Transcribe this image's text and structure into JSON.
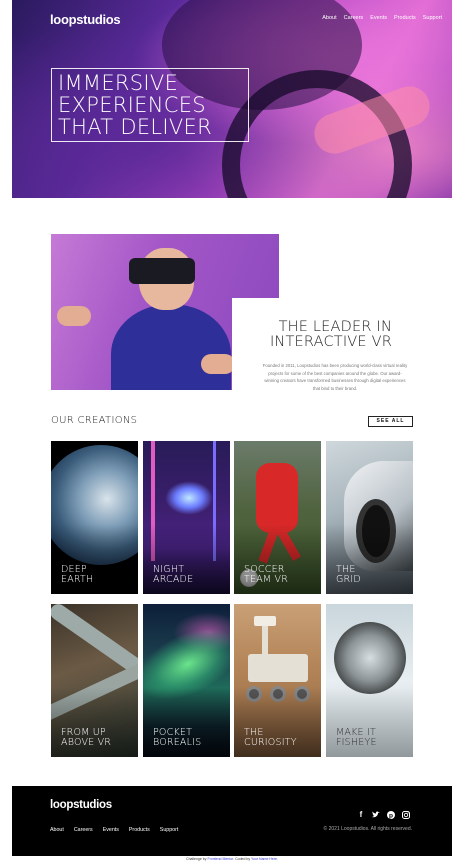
{
  "header": {
    "logo": "loopstudios",
    "nav": [
      "About",
      "Careers",
      "Events",
      "Products",
      "Support"
    ],
    "headline": [
      "IMMERSIVE",
      "EXPERIENCES",
      "THAT DELIVER"
    ]
  },
  "interactive": {
    "title": [
      "THE LEADER IN",
      "INTERACTIVE VR"
    ],
    "body": "Founded in 2011, Loopstudios has been producing world-class virtual reality projects for some of the best companies around the globe. Our award-winning creators have transformed businesses through digital experiences that bind to their brand."
  },
  "creations": {
    "title": "OUR CREATIONS",
    "see_all": "SEE ALL",
    "items": [
      {
        "lines": [
          "DEEP",
          "EARTH"
        ]
      },
      {
        "lines": [
          "NIGHT",
          "ARCADE"
        ]
      },
      {
        "lines": [
          "SOCCER",
          "TEAM VR"
        ]
      },
      {
        "lines": [
          "THE",
          "GRID"
        ]
      },
      {
        "lines": [
          "FROM UP",
          "ABOVE VR"
        ]
      },
      {
        "lines": [
          "POCKET",
          "BOREALIS"
        ]
      },
      {
        "lines": [
          "THE",
          "CURIOSITY"
        ]
      },
      {
        "lines": [
          "MAKE IT",
          "FISHEYE"
        ]
      }
    ]
  },
  "footer": {
    "logo": "loopstudios",
    "nav": [
      "About",
      "Careers",
      "Events",
      "Products",
      "Support"
    ],
    "socials": [
      "facebook-icon",
      "twitter-icon",
      "pinterest-icon",
      "instagram-icon"
    ],
    "copyright": "© 2021 Loopstudios. All rights reserved."
  },
  "attribution": {
    "prefix": "Challenge by",
    "link1": "Frontend Mentor",
    "middle": ". Coded by",
    "link2": "Your Name Here",
    "suffix": "."
  }
}
